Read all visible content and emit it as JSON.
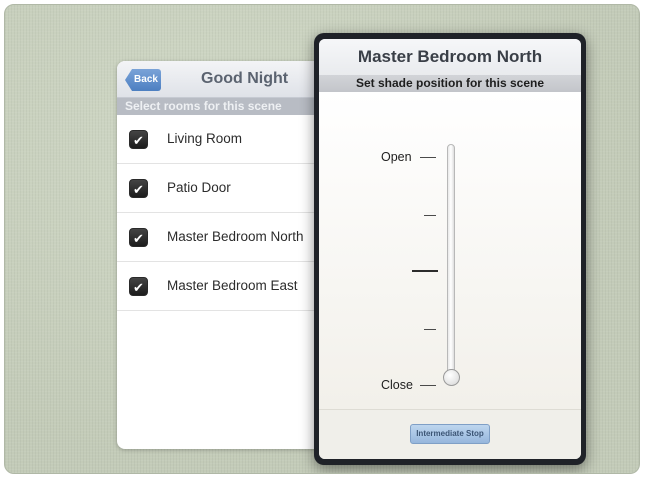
{
  "scene": {
    "back_label": "Back",
    "title": "Good Night",
    "subtitle": "Select rooms for this scene",
    "rooms": [
      {
        "label": "Living Room",
        "checked": true
      },
      {
        "label": "Patio Door",
        "checked": true
      },
      {
        "label": "Master Bedroom North",
        "checked": true
      },
      {
        "label": "Master Bedroom East",
        "checked": true
      }
    ],
    "check_glyph": "✔"
  },
  "modal": {
    "title": "Master Bedroom North",
    "subtitle": "Set shade position for this scene",
    "slider": {
      "top_label": "Open",
      "bottom_label": "Close",
      "value": 0
    },
    "intermediate_button_label": "Intermediate Stop"
  },
  "colors": {
    "background": "#c7cfbd",
    "accent_blue": "#4d7fc1",
    "modal_frame": "#1f2228"
  }
}
